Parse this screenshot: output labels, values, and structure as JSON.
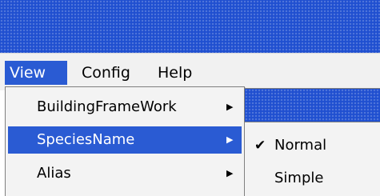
{
  "colors": {
    "title_bar": "#1f4fd0",
    "selection": "#2a5bd3",
    "menu_bg": "#f3f3f3"
  },
  "menubar": {
    "items": [
      {
        "label": "View"
      },
      {
        "label": "Config"
      },
      {
        "label": "Help"
      }
    ]
  },
  "view_menu": {
    "items": [
      {
        "label": "BuildingFrameWork",
        "icon": "triangle-right-icon"
      },
      {
        "label": "SpeciesName",
        "icon": "triangle-right-icon",
        "selected": true
      },
      {
        "label": "Alias",
        "icon": "triangle-right-icon"
      }
    ]
  },
  "species_menu": {
    "items": [
      {
        "label": "Normal",
        "checked": true,
        "icon": "checkmark-icon"
      },
      {
        "label": "Simple",
        "checked": false
      }
    ]
  }
}
